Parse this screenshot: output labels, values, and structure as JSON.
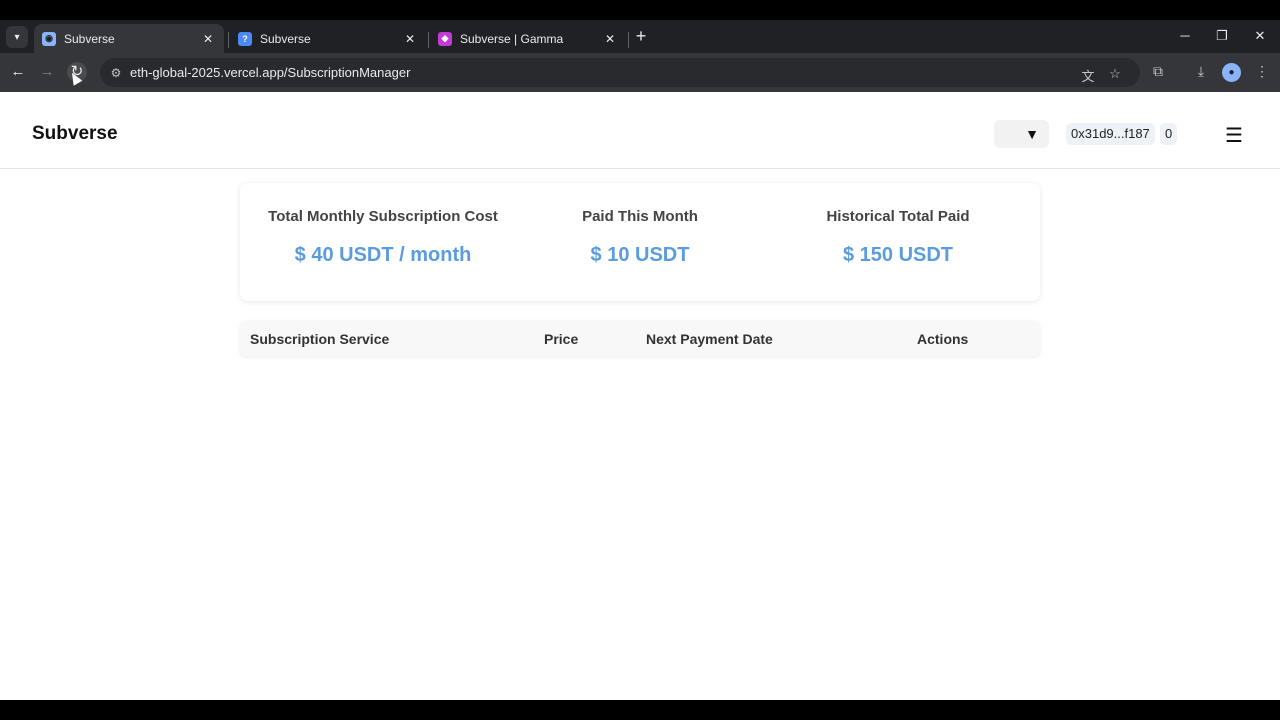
{
  "browser": {
    "tabs": [
      {
        "title": "Subverse",
        "icon": "chrome-page-icon",
        "active": true
      },
      {
        "title": "Subverse",
        "icon": "docs-icon",
        "active": false
      },
      {
        "title": "Subverse | Gamma",
        "icon": "gamma-icon",
        "active": false
      }
    ],
    "url": "eth-global-2025.vercel.app/SubscriptionManager",
    "new_tab_symbol": "+"
  },
  "app": {
    "brand": "Subverse",
    "network_select": {
      "value": "",
      "arrow": "▼"
    },
    "wallet_address": "0x31d9...f187",
    "wallet_count": "0",
    "menu_symbol": "☰"
  },
  "stats": [
    {
      "label": "Total Monthly Subscription Cost",
      "value": "$ 40 USDT / month"
    },
    {
      "label": "Paid This Month",
      "value": "$ 10 USDT"
    },
    {
      "label": "Historical Total Paid",
      "value": "$ 150 USDT"
    }
  ],
  "table": {
    "headers": [
      "Subscription Service",
      "Price",
      "Next Payment Date",
      "Actions"
    ]
  },
  "colors": {
    "accent": "#5b9be0",
    "chrome_dark": "#202124",
    "chrome_toolbar": "#35363a"
  }
}
